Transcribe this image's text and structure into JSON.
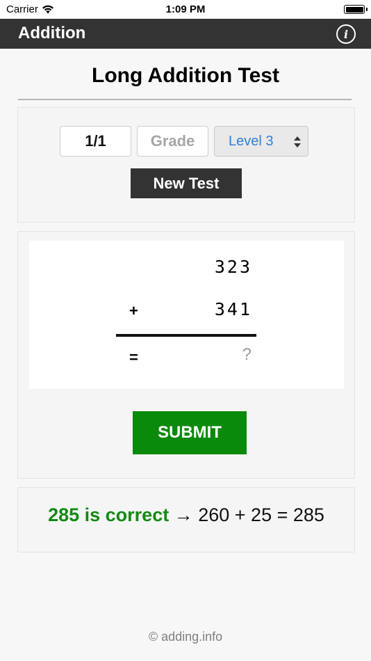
{
  "status": {
    "carrier": "Carrier",
    "time": "1:09 PM"
  },
  "nav": {
    "title": "Addition",
    "info_symbol": "i"
  },
  "page": {
    "title": "Long Addition Test"
  },
  "controls": {
    "count": "1/1",
    "grade_placeholder": "Grade",
    "level_selected": "Level 3",
    "new_test_label": "New Test"
  },
  "problem": {
    "addend_top": "323",
    "addend_bottom": "341",
    "plus_sign": "+",
    "equals_sign": "=",
    "answer_placeholder": "?",
    "submit_label": "SUBMIT"
  },
  "result": {
    "correct_text": "285 is correct",
    "explanation": "→ 260 + 25 = 285"
  },
  "footer": {
    "text": "© adding.info"
  },
  "colors": {
    "nav_background": "#333333",
    "submit_green": "#0a8a0a",
    "correct_green": "#138a13",
    "level_blue": "#2f7fd6"
  },
  "icons": {
    "wifi": "wifi-icon",
    "battery": "battery-icon",
    "info": "info-icon",
    "select_arrows": "select-arrows-icon"
  }
}
